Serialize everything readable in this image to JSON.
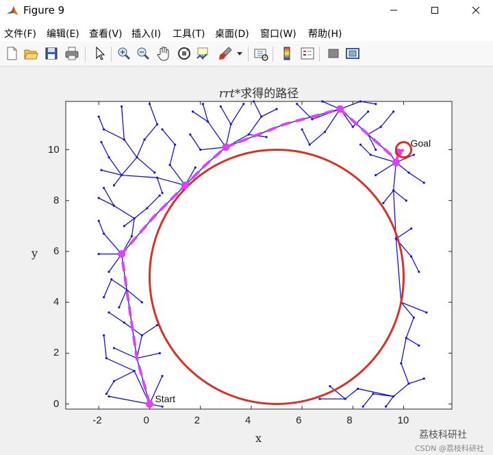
{
  "window": {
    "title": "Figure 9",
    "minimize_icon": "minimize-icon",
    "maximize_icon": "maximize-icon",
    "close_icon": "close-icon"
  },
  "menu": [
    "文件(F)",
    "编辑(E)",
    "查看(V)",
    "插入(I)",
    "工具(T)",
    "桌面(D)",
    "窗口(W)",
    "帮助(H)"
  ],
  "toolbar": [
    "new-figure-icon",
    "open-file-icon",
    "save-icon",
    "print-icon",
    "select-arrow-icon",
    "zoom-in-icon",
    "zoom-out-icon",
    "pan-hand-icon",
    "rotate-3d-icon",
    "data-cursor-icon",
    "brush-icon",
    "brush-dropdown-icon",
    "link-plot-icon",
    "colorbar-icon",
    "legend-icon",
    "hide-plot-tools-icon",
    "show-plot-tools-icon"
  ],
  "colors": {
    "tree": "#1010e0",
    "circle": "#d93025",
    "path": "#e040fb"
  },
  "chart_data": {
    "type": "line",
    "title_italic": "rrt",
    "title_rest": "*求得的路径",
    "xlabel": "x",
    "ylabel": "y",
    "xlim": [
      -3.3,
      11.9
    ],
    "ylim": [
      -0.2,
      11.9
    ],
    "xticks": [
      -2,
      0,
      2,
      4,
      6,
      8,
      10
    ],
    "yticks": [
      0,
      2,
      4,
      6,
      8,
      10
    ],
    "obstacle": {
      "cx": 5,
      "cy": 5,
      "r": 5
    },
    "start": {
      "x": 0,
      "y": 0,
      "label": "Start"
    },
    "goal": {
      "x": 10,
      "y": 10,
      "label": "Goal",
      "r": 0.3
    },
    "path": [
      [
        0,
        0
      ],
      [
        -0.5,
        1.8
      ],
      [
        -0.9,
        4.5
      ],
      [
        -1.1,
        5.9
      ],
      [
        0.2,
        7.4
      ],
      [
        1.4,
        8.6
      ],
      [
        2.2,
        9.4
      ],
      [
        3,
        10.1
      ],
      [
        5.3,
        11.0
      ],
      [
        7.5,
        11.6
      ],
      [
        8.6,
        10.6
      ],
      [
        9.5,
        9.8
      ],
      [
        9.7,
        9.5
      ],
      [
        9.8,
        9.9
      ],
      [
        10,
        10
      ]
    ],
    "tree_edges": [
      [
        [
          0,
          0
        ],
        [
          -0.6,
          1.3
        ]
      ],
      [
        [
          0,
          0
        ],
        [
          0.5,
          1.1
        ]
      ],
      [
        [
          0,
          0
        ],
        [
          -1.6,
          0.3
        ]
      ],
      [
        [
          0,
          0
        ],
        [
          0.5,
          -0.1
        ]
      ],
      [
        [
          -0.6,
          1.3
        ],
        [
          -1.7,
          1.8
        ]
      ],
      [
        [
          -0.6,
          1.3
        ],
        [
          -1.4,
          0.9
        ]
      ],
      [
        [
          -0.5,
          1.8
        ],
        [
          -1.4,
          2.2
        ]
      ],
      [
        [
          -0.5,
          1.8
        ],
        [
          0.4,
          2.0
        ]
      ],
      [
        [
          -0.5,
          1.8
        ],
        [
          -0.3,
          2.7
        ]
      ],
      [
        [
          -0.3,
          2.7
        ],
        [
          -1.0,
          3.2
        ]
      ],
      [
        [
          -0.3,
          2.7
        ],
        [
          0.3,
          3.1
        ]
      ],
      [
        [
          -1.0,
          3.2
        ],
        [
          -1.6,
          3.6
        ]
      ],
      [
        [
          -0.9,
          4.5
        ],
        [
          -1.5,
          4.9
        ]
      ],
      [
        [
          -0.9,
          4.5
        ],
        [
          -0.3,
          4.0
        ]
      ],
      [
        [
          -0.9,
          4.5
        ],
        [
          -1.2,
          3.8
        ]
      ],
      [
        [
          -1.5,
          4.9
        ],
        [
          -1.8,
          4.2
        ]
      ],
      [
        [
          -1.7,
          1.8
        ],
        [
          -1.8,
          2.7
        ]
      ],
      [
        [
          -1.4,
          0.9
        ],
        [
          -1.7,
          0.4
        ]
      ],
      [
        [
          -1.1,
          5.9
        ],
        [
          -2.0,
          5.9
        ]
      ],
      [
        [
          -1.1,
          5.9
        ],
        [
          -1.8,
          6.7
        ]
      ],
      [
        [
          -1.1,
          5.9
        ],
        [
          -0.7,
          6.6
        ]
      ],
      [
        [
          -1.1,
          5.9
        ],
        [
          -1.6,
          5.2
        ]
      ],
      [
        [
          -1.8,
          6.7
        ],
        [
          -2.0,
          7.2
        ]
      ],
      [
        [
          -0.7,
          6.6
        ],
        [
          -0.6,
          7.3
        ]
      ],
      [
        [
          -0.6,
          7.3
        ],
        [
          -1.4,
          7.8
        ]
      ],
      [
        [
          -0.6,
          7.3
        ],
        [
          -0.1,
          7.7
        ]
      ],
      [
        [
          -1.4,
          7.8
        ],
        [
          -1.8,
          8.5
        ]
      ],
      [
        [
          -1.4,
          7.8
        ],
        [
          -2.0,
          8.1
        ]
      ],
      [
        [
          -0.1,
          7.7
        ],
        [
          0.4,
          8.2
        ]
      ],
      [
        [
          -0.6,
          7.3
        ],
        [
          -1.0,
          7.0
        ]
      ],
      [
        [
          1.4,
          8.6
        ],
        [
          0.3,
          8.9
        ]
      ],
      [
        [
          1.4,
          8.6
        ],
        [
          0.8,
          9.4
        ]
      ],
      [
        [
          1.4,
          8.6
        ],
        [
          1.8,
          9.3
        ]
      ],
      [
        [
          0.3,
          8.9
        ],
        [
          -1.1,
          9.0
        ]
      ],
      [
        [
          -1.1,
          9.0
        ],
        [
          -1.9,
          9.2
        ]
      ],
      [
        [
          -1.1,
          9.0
        ],
        [
          -1.6,
          9.7
        ]
      ],
      [
        [
          -1.1,
          9.0
        ],
        [
          -0.5,
          9.7
        ]
      ],
      [
        [
          -1.1,
          9.0
        ],
        [
          -1.4,
          8.6
        ]
      ],
      [
        [
          -1.6,
          9.7
        ],
        [
          -1.9,
          10.3
        ]
      ],
      [
        [
          -0.5,
          9.7
        ],
        [
          -0.2,
          10.4
        ]
      ],
      [
        [
          -0.5,
          9.7
        ],
        [
          -1.0,
          10.4
        ]
      ],
      [
        [
          -1.0,
          10.4
        ],
        [
          -1.8,
          10.8
        ]
      ],
      [
        [
          -1.0,
          10.4
        ],
        [
          -1.1,
          11.7
        ]
      ],
      [
        [
          -1.8,
          10.8
        ],
        [
          -2.0,
          11.3
        ]
      ],
      [
        [
          -0.2,
          10.4
        ],
        [
          0.3,
          11.0
        ]
      ],
      [
        [
          0.3,
          11.0
        ],
        [
          0.0,
          11.8
        ]
      ],
      [
        [
          0.8,
          9.4
        ],
        [
          1.0,
          10.2
        ]
      ],
      [
        [
          1.0,
          10.2
        ],
        [
          0.5,
          10.8
        ]
      ],
      [
        [
          -0.5,
          9.7
        ],
        [
          0.2,
          9.1
        ]
      ],
      [
        [
          0.3,
          8.9
        ],
        [
          0.5,
          8.3
        ]
      ],
      [
        [
          3,
          10.1
        ],
        [
          2.0,
          10.0
        ]
      ],
      [
        [
          3,
          10.1
        ],
        [
          2.3,
          11.1
        ]
      ],
      [
        [
          3,
          10.1
        ],
        [
          3.2,
          11.0
        ]
      ],
      [
        [
          3,
          10.1
        ],
        [
          3.9,
          10.6
        ]
      ],
      [
        [
          2.3,
          11.1
        ],
        [
          2.1,
          11.8
        ]
      ],
      [
        [
          2.3,
          11.1
        ],
        [
          1.7,
          11.5
        ]
      ],
      [
        [
          3.2,
          11.0
        ],
        [
          3.7,
          11.8
        ]
      ],
      [
        [
          3.2,
          11.0
        ],
        [
          2.8,
          11.7
        ]
      ],
      [
        [
          3.9,
          10.6
        ],
        [
          4.4,
          11.3
        ]
      ],
      [
        [
          4.4,
          11.3
        ],
        [
          4.1,
          11.9
        ]
      ],
      [
        [
          4.4,
          11.3
        ],
        [
          5.0,
          11.6
        ]
      ],
      [
        [
          2.0,
          10.0
        ],
        [
          1.6,
          10.6
        ]
      ],
      [
        [
          3.9,
          10.6
        ],
        [
          4.6,
          10.5
        ]
      ],
      [
        [
          7.5,
          11.6
        ],
        [
          6.4,
          11.2
        ]
      ],
      [
        [
          7.5,
          11.6
        ],
        [
          6.8,
          11.9
        ]
      ],
      [
        [
          7.5,
          11.6
        ],
        [
          8.3,
          11.9
        ]
      ],
      [
        [
          7.5,
          11.6
        ],
        [
          8.0,
          10.9
        ]
      ],
      [
        [
          7.5,
          11.6
        ],
        [
          6.9,
          10.7
        ]
      ],
      [
        [
          6.9,
          10.7
        ],
        [
          6.3,
          10.2
        ]
      ],
      [
        [
          6.4,
          11.2
        ],
        [
          5.8,
          11.8
        ]
      ],
      [
        [
          8.0,
          10.9
        ],
        [
          8.6,
          11.5
        ]
      ],
      [
        [
          8.6,
          10.6
        ],
        [
          9.1,
          10.9
        ]
      ],
      [
        [
          8.6,
          10.6
        ],
        [
          8.9,
          10.0
        ]
      ],
      [
        [
          9.1,
          10.9
        ],
        [
          9.6,
          11.5
        ]
      ],
      [
        [
          6.3,
          10.2
        ],
        [
          6.0,
          10.8
        ]
      ],
      [
        [
          8.3,
          11.9
        ],
        [
          8.9,
          11.8
        ]
      ],
      [
        [
          9.7,
          9.5
        ],
        [
          8.7,
          9.8
        ]
      ],
      [
        [
          9.7,
          9.5
        ],
        [
          8.9,
          9.0
        ]
      ],
      [
        [
          9.7,
          9.5
        ],
        [
          10.2,
          9.1
        ]
      ],
      [
        [
          9.7,
          9.5
        ],
        [
          9.6,
          8.4
        ]
      ],
      [
        [
          9.7,
          9.5
        ],
        [
          10.4,
          9.8
        ]
      ],
      [
        [
          9.6,
          8.4
        ],
        [
          9.2,
          7.9
        ]
      ],
      [
        [
          9.6,
          8.4
        ],
        [
          10.1,
          8.0
        ]
      ],
      [
        [
          9.6,
          8.4
        ],
        [
          9.7,
          6.5
        ]
      ],
      [
        [
          8.7,
          9.8
        ],
        [
          8.3,
          10.2
        ]
      ],
      [
        [
          10.2,
          9.1
        ],
        [
          10.8,
          8.7
        ]
      ],
      [
        [
          9.7,
          6.5
        ],
        [
          10.3,
          6.9
        ]
      ],
      [
        [
          9.7,
          6.5
        ],
        [
          10.3,
          5.8
        ]
      ],
      [
        [
          10.3,
          5.8
        ],
        [
          10.6,
          5.2
        ]
      ],
      [
        [
          9.7,
          6.5
        ],
        [
          9.9,
          4.0
        ]
      ],
      [
        [
          9.9,
          4.0
        ],
        [
          10.4,
          3.4
        ]
      ],
      [
        [
          9.9,
          4.0
        ],
        [
          10.9,
          3.6
        ]
      ],
      [
        [
          10.4,
          3.4
        ],
        [
          10.1,
          2.6
        ]
      ],
      [
        [
          10.1,
          2.6
        ],
        [
          9.9,
          1.6
        ]
      ],
      [
        [
          10.1,
          2.6
        ],
        [
          10.6,
          2.3
        ]
      ],
      [
        [
          9.9,
          1.6
        ],
        [
          10.2,
          0.8
        ]
      ],
      [
        [
          10.2,
          0.8
        ],
        [
          9.6,
          0.3
        ]
      ],
      [
        [
          9.6,
          0.3
        ],
        [
          8.8,
          0.4
        ]
      ],
      [
        [
          9.6,
          0.3
        ],
        [
          8.2,
          0.6
        ]
      ],
      [
        [
          8.2,
          0.6
        ],
        [
          7.7,
          0.2
        ]
      ],
      [
        [
          8.8,
          0.4
        ],
        [
          8.4,
          -0.1
        ]
      ],
      [
        [
          7.7,
          0.2
        ],
        [
          6.7,
          0.2
        ]
      ],
      [
        [
          7.7,
          0.2
        ],
        [
          7.1,
          0.7
        ]
      ],
      [
        [
          9.6,
          0.3
        ],
        [
          9.3,
          -0.1
        ]
      ],
      [
        [
          10.2,
          0.8
        ],
        [
          10.8,
          1.0
        ]
      ]
    ]
  },
  "watermark": {
    "line1": "荔枝科研社",
    "line2": "CSDN @荔枝科研社"
  }
}
